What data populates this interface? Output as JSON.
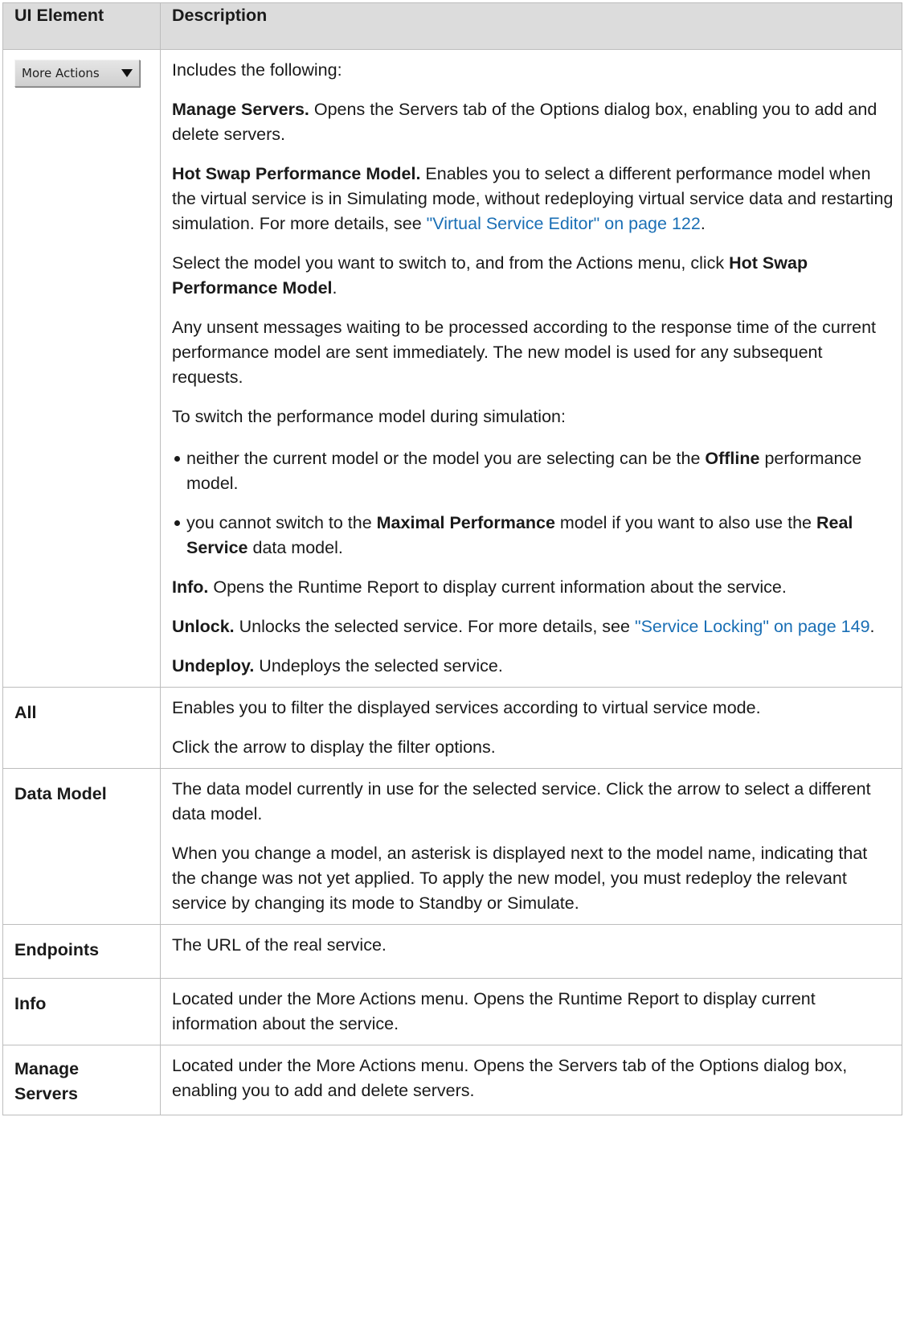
{
  "table": {
    "header": {
      "col1": "UI Element",
      "col2": "Description"
    },
    "rows": {
      "more_actions": {
        "button_label": "More Actions",
        "intro": "Includes the following:",
        "manage_servers": {
          "term": "Manage Servers.",
          "text": " Opens the Servers tab of the Options dialog box, enabling you to add and delete servers."
        },
        "hot_swap": {
          "term": "Hot Swap Performance Model.",
          "text": " Enables you to select a different performance model when the virtual service is in Simulating mode, without redeploying virtual service data and restarting simulation. For more details, see ",
          "link": "\"Virtual Service Editor\" on page 122",
          "after": "."
        },
        "select_model": {
          "text": "Select the model you want to switch to, and from the Actions menu, click ",
          "bold": "Hot Swap Performance Model",
          "after": "."
        },
        "unsent": "Any unsent messages waiting to be processed according to the response time of the current performance model are sent immediately. The new model is used for any subsequent requests.",
        "switch_intro": "To switch the performance model during simulation:",
        "bullet1": {
          "text": "neither the current model or the model you are selecting can be the ",
          "bold": "Offline",
          "after": " performance model."
        },
        "bullet2": {
          "text": "you cannot switch to the ",
          "bold1": "Maximal Performance",
          "mid": " model if you want to also use the ",
          "bold2": "Real Service",
          "after": " data model."
        },
        "info": {
          "term": "Info.",
          "text": " Opens the Runtime Report to display current information about the service."
        },
        "unlock": {
          "term": "Unlock.",
          "text": " Unlocks the selected service. For more details, see ",
          "link": "\"Service Locking\" on page 149",
          "after": "."
        },
        "undeploy": {
          "term": "Undeploy.",
          "text": " Undeploys the selected service."
        }
      },
      "all": {
        "label": "All",
        "p1": "Enables you to filter the displayed services according to virtual service mode.",
        "p2": "Click the arrow to display the filter options."
      },
      "data_model": {
        "label": "Data Model",
        "p1": "The data model currently in use for the selected service. Click the arrow to select a different data model.",
        "p2": "When you change a model, an asterisk is displayed next to the model name, indicating that the change was not yet applied. To apply the new model, you must redeploy the relevant service by changing its mode to Standby or Simulate."
      },
      "endpoints": {
        "label": "Endpoints",
        "p1": "The URL of the real service."
      },
      "info": {
        "label": "Info",
        "p1": "Located under the More Actions menu. Opens the Runtime Report to display current information about the service."
      },
      "manage_servers": {
        "label_line1": "Manage",
        "label_line2": "Servers",
        "p1": "Located under the More Actions menu. Opens the Servers tab of the Options dialog box, enabling you to add and delete servers."
      }
    }
  },
  "colors": {
    "header_bg": "#dcdcdc",
    "border": "#bdbdbd",
    "link": "#1a6fb5",
    "text": "#1a1a1a"
  },
  "icons": {
    "more_actions_arrow": "triangle-down-icon"
  }
}
